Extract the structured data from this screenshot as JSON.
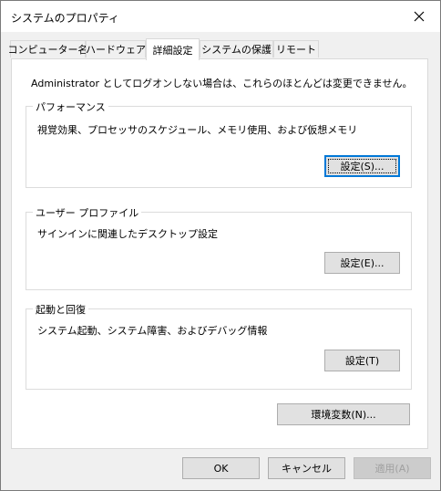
{
  "window": {
    "title": "システムのプロパティ"
  },
  "tabs": [
    {
      "label": "コンピューター名"
    },
    {
      "label": "ハードウェア"
    },
    {
      "label": "詳細設定"
    },
    {
      "label": "システムの保護"
    },
    {
      "label": "リモート"
    }
  ],
  "intro_text": "Administrator としてログオンしない場合は、これらのほとんどは変更できません。",
  "groups": {
    "performance": {
      "title": "パフォーマンス",
      "description": "視覚効果、プロセッサのスケジュール、メモリ使用、および仮想メモリ",
      "button": "設定(S)..."
    },
    "user_profile": {
      "title": "ユーザー プロファイル",
      "description": "サインインに関連したデスクトップ設定",
      "button": "設定(E)..."
    },
    "startup_recovery": {
      "title": "起動と回復",
      "description": "システム起動、システム障害、およびデバッグ情報",
      "button": "設定(T)"
    }
  },
  "env_button": "環境変数(N)...",
  "footer": {
    "ok": "OK",
    "cancel": "キャンセル",
    "apply": "適用(A)"
  },
  "colors": {
    "focus": "#0078d7",
    "window_bg": "#f0f0f0",
    "panel_bg": "#ffffff"
  }
}
